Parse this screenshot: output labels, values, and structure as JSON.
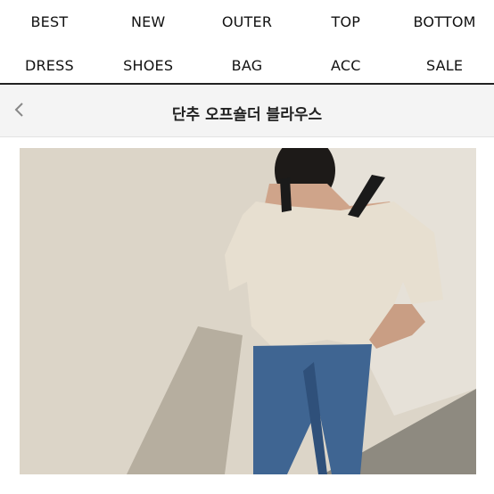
{
  "nav": {
    "row1": [
      "BEST",
      "NEW",
      "OUTER",
      "TOP",
      "BOTTOM"
    ],
    "row2": [
      "DRESS",
      "SHOES",
      "BAG",
      "ACC",
      "SALE"
    ]
  },
  "header": {
    "back_icon": "chevron-left-icon",
    "title": "단추 오프숄더 블라우스"
  },
  "product": {
    "image_subject": "product-photo"
  },
  "colors": {
    "header_bg": "#f4f4f4",
    "nav_rule": "#222222",
    "wall": "#dcd5c8",
    "blouse": "#e7dfd0",
    "jeans": "#3f6592"
  }
}
